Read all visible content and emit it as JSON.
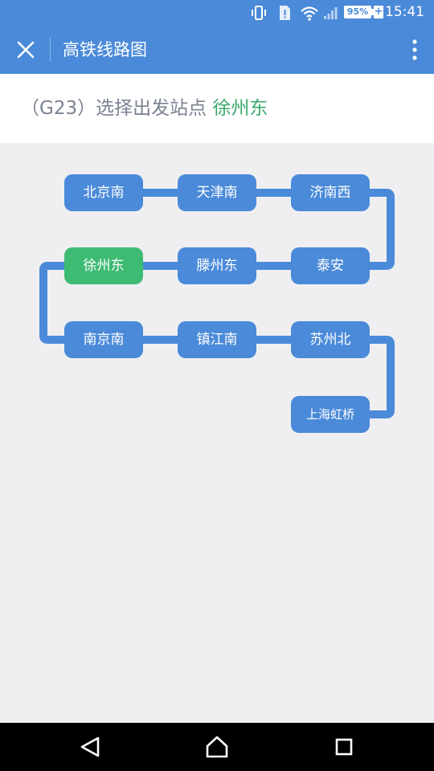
{
  "status_bar": {
    "time": "15:41",
    "battery": "95%",
    "icons": [
      "vibrate-icon",
      "notification-icon",
      "wifi-icon",
      "signal-icon",
      "battery-icon",
      "charging-icon"
    ]
  },
  "app_bar": {
    "title": "高铁线路图",
    "close_icon": "close-icon",
    "more_icon": "more-vert-icon"
  },
  "header": {
    "prefix": "（G23）选择出发站点 ",
    "selected_station": "徐州东"
  },
  "route": {
    "line": "G23",
    "stations": [
      {
        "name": "北京南",
        "selected": false
      },
      {
        "name": "天津南",
        "selected": false
      },
      {
        "name": "济南西",
        "selected": false
      },
      {
        "name": "泰安",
        "selected": false
      },
      {
        "name": "滕州东",
        "selected": false
      },
      {
        "name": "徐州东",
        "selected": true
      },
      {
        "name": "南京南",
        "selected": false
      },
      {
        "name": "镇江南",
        "selected": false
      },
      {
        "name": "苏州北",
        "selected": false
      },
      {
        "name": "上海虹桥",
        "selected": false
      }
    ],
    "colors": {
      "line": "#4a8ad9",
      "station": "#4a8ad9",
      "selected_station": "#3dbb73"
    }
  },
  "nav_bar": {
    "back_icon": "back-triangle-icon",
    "home_icon": "home-icon",
    "recents_icon": "recents-square-icon"
  }
}
